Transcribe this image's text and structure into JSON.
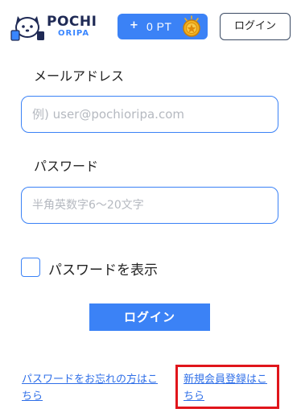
{
  "header": {
    "logo": {
      "line1": "POCHI",
      "line2": "ORIPA"
    },
    "points": {
      "plus": "+",
      "value": "0 PT",
      "coin_icon": "coin-icon"
    },
    "login_button": "ログイン"
  },
  "form": {
    "email": {
      "label": "メールアドレス",
      "placeholder": "例) user@pochioripa.com",
      "value": ""
    },
    "password": {
      "label": "パスワード",
      "placeholder": "半角英数字6〜20文字",
      "value": ""
    },
    "show_password": {
      "label": "パスワードを表示",
      "checked": false
    },
    "submit_label": "ログイン"
  },
  "links": {
    "forgot_password": "パスワードをお忘れの方はこちら",
    "register": "新規会員登録はこちら"
  },
  "colors": {
    "accent": "#3b82f6",
    "logo_dark": "#1f2a55",
    "link": "#2f6fe8",
    "highlight": "#e0151b"
  }
}
